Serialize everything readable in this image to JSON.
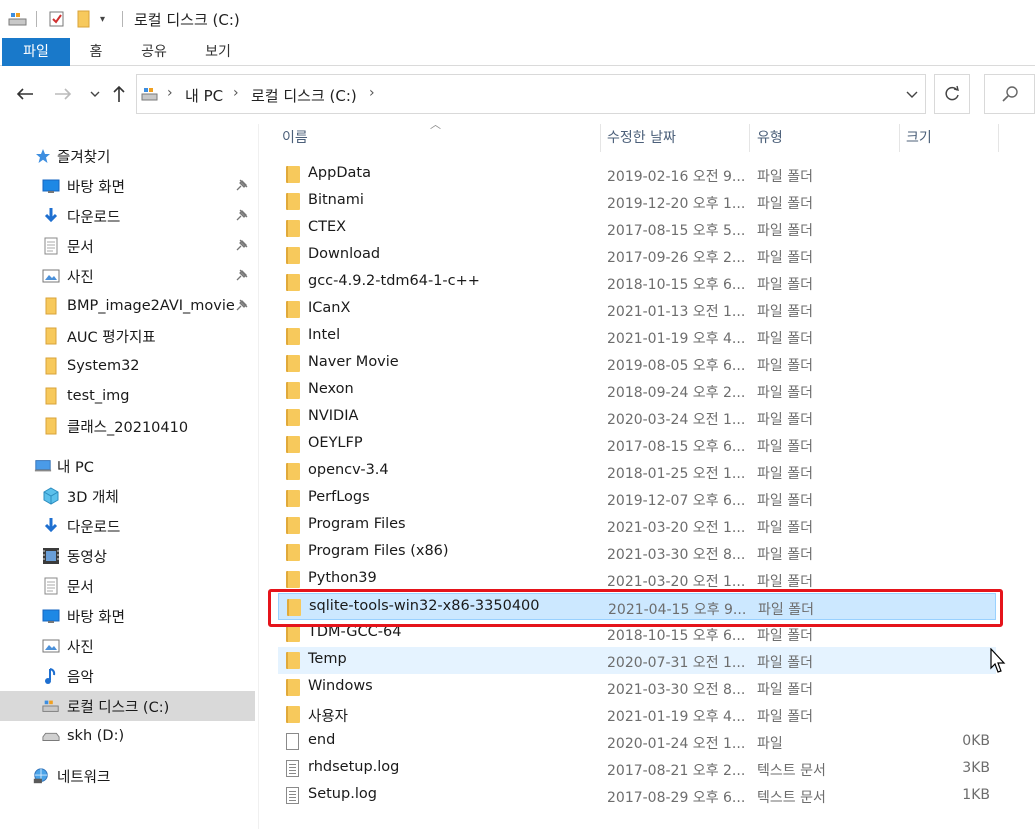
{
  "window": {
    "title": "로컬 디스크 (C:)"
  },
  "ribbon": {
    "tabs": [
      "파일",
      "홈",
      "공유",
      "보기"
    ]
  },
  "address": {
    "crumbs": [
      "내 PC",
      "로컬 디스크 (C:)"
    ]
  },
  "nav": {
    "quick_access": "즐겨찾기",
    "quick_items": [
      {
        "label": "바탕 화면",
        "icon": "desktop-icon",
        "pinned": true
      },
      {
        "label": "다운로드",
        "icon": "download-icon",
        "pinned": true
      },
      {
        "label": "문서",
        "icon": "document-icon",
        "pinned": true
      },
      {
        "label": "사진",
        "icon": "pictures-icon",
        "pinned": true
      },
      {
        "label": "BMP_image2AVI_movie",
        "icon": "folder-icon",
        "pinned": true
      },
      {
        "label": "AUC 평가지표",
        "icon": "folder-icon",
        "pinned": false
      },
      {
        "label": "System32",
        "icon": "folder-icon",
        "pinned": false
      },
      {
        "label": "test_img",
        "icon": "folder-icon",
        "pinned": false
      },
      {
        "label": "클래스_20210410",
        "icon": "folder-icon",
        "pinned": false
      }
    ],
    "this_pc": "내 PC",
    "pc_items": [
      {
        "label": "3D 개체",
        "icon": "3d-objects-icon"
      },
      {
        "label": "다운로드",
        "icon": "download-icon"
      },
      {
        "label": "동영상",
        "icon": "video-icon"
      },
      {
        "label": "문서",
        "icon": "document-icon"
      },
      {
        "label": "바탕 화면",
        "icon": "desktop-icon"
      },
      {
        "label": "사진",
        "icon": "pictures-icon"
      },
      {
        "label": "음악",
        "icon": "music-icon"
      },
      {
        "label": "로컬 디스크 (C:)",
        "icon": "drive-icon"
      },
      {
        "label": "skh (D:)",
        "icon": "drive-icon"
      }
    ],
    "network": "네트워크"
  },
  "columns": {
    "name": "이름",
    "date": "수정한 날짜",
    "type": "유형",
    "size": "크기"
  },
  "files": [
    {
      "name": "AppData",
      "date": "2019-02-16 오전 9...",
      "type": "파일 폴더",
      "size": "",
      "kind": "folder"
    },
    {
      "name": "Bitnami",
      "date": "2019-12-20 오후 1...",
      "type": "파일 폴더",
      "size": "",
      "kind": "folder"
    },
    {
      "name": "CTEX",
      "date": "2017-08-15 오후 5...",
      "type": "파일 폴더",
      "size": "",
      "kind": "folder"
    },
    {
      "name": "Download",
      "date": "2017-09-26 오후 2...",
      "type": "파일 폴더",
      "size": "",
      "kind": "folder"
    },
    {
      "name": "gcc-4.9.2-tdm64-1-c++",
      "date": "2018-10-15 오후 6...",
      "type": "파일 폴더",
      "size": "",
      "kind": "folder"
    },
    {
      "name": "ICanX",
      "date": "2021-01-13 오전 1...",
      "type": "파일 폴더",
      "size": "",
      "kind": "folder"
    },
    {
      "name": "Intel",
      "date": "2021-01-19 오후 4...",
      "type": "파일 폴더",
      "size": "",
      "kind": "folder"
    },
    {
      "name": "Naver Movie",
      "date": "2019-08-05 오후 6...",
      "type": "파일 폴더",
      "size": "",
      "kind": "folder"
    },
    {
      "name": "Nexon",
      "date": "2018-09-24 오후 2...",
      "type": "파일 폴더",
      "size": "",
      "kind": "folder"
    },
    {
      "name": "NVIDIA",
      "date": "2020-03-24 오전 1...",
      "type": "파일 폴더",
      "size": "",
      "kind": "folder"
    },
    {
      "name": "OEYLFP",
      "date": "2017-08-15 오후 6...",
      "type": "파일 폴더",
      "size": "",
      "kind": "folder"
    },
    {
      "name": "opencv-3.4",
      "date": "2018-01-25 오전 1...",
      "type": "파일 폴더",
      "size": "",
      "kind": "folder"
    },
    {
      "name": "PerfLogs",
      "date": "2019-12-07 오후 6...",
      "type": "파일 폴더",
      "size": "",
      "kind": "folder"
    },
    {
      "name": "Program Files",
      "date": "2021-03-20 오전 1...",
      "type": "파일 폴더",
      "size": "",
      "kind": "folder"
    },
    {
      "name": "Program Files (x86)",
      "date": "2021-03-30 오전 8...",
      "type": "파일 폴더",
      "size": "",
      "kind": "folder"
    },
    {
      "name": "Python39",
      "date": "2021-03-20 오전 1...",
      "type": "파일 폴더",
      "size": "",
      "kind": "folder"
    },
    {
      "name": "sqlite-tools-win32-x86-3350400",
      "date": "2021-04-15 오후 9...",
      "type": "파일 폴더",
      "size": "",
      "kind": "folder",
      "state": "selected"
    },
    {
      "name": "TDM-GCC-64",
      "date": "2018-10-15 오후 6...",
      "type": "파일 폴더",
      "size": "",
      "kind": "folder"
    },
    {
      "name": "Temp",
      "date": "2020-07-31 오전 1...",
      "type": "파일 폴더",
      "size": "",
      "kind": "folder",
      "state": "hover"
    },
    {
      "name": "Windows",
      "date": "2021-03-30 오전 8...",
      "type": "파일 폴더",
      "size": "",
      "kind": "folder"
    },
    {
      "name": "사용자",
      "date": "2021-01-19 오후 4...",
      "type": "파일 폴더",
      "size": "",
      "kind": "folder"
    },
    {
      "name": "end",
      "date": "2020-01-24 오전 1...",
      "type": "파일",
      "size": "0KB",
      "kind": "file"
    },
    {
      "name": "rhdsetup.log",
      "date": "2017-08-21 오후 2...",
      "type": "텍스트 문서",
      "size": "3KB",
      "kind": "log"
    },
    {
      "name": "Setup.log",
      "date": "2017-08-29 오후 6...",
      "type": "텍스트 문서",
      "size": "1KB",
      "kind": "log"
    }
  ],
  "colors": {
    "accent": "#1979ca",
    "selection_bg": "#cce8ff",
    "hover_bg": "#e5f3ff",
    "highlight": "#e5141b",
    "folder": "#f7c95c"
  }
}
